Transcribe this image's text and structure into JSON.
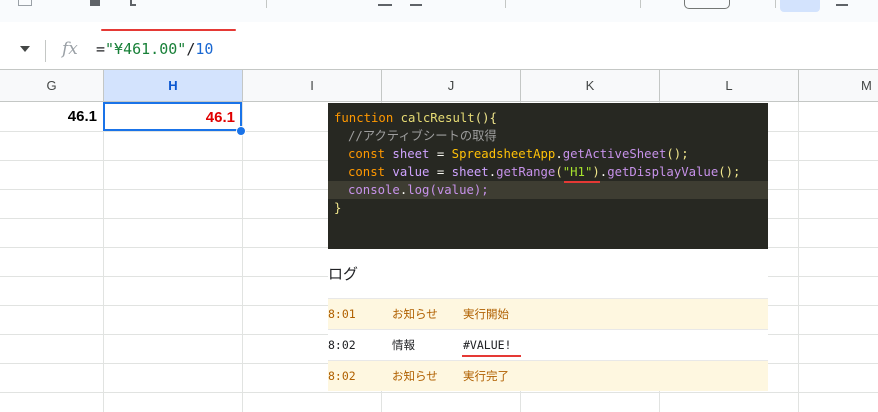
{
  "formula_bar": {
    "fx_label": "fx",
    "formula_prefix": "=",
    "formula_string": "\"¥461.00\"",
    "formula_operator": "/",
    "formula_number": "10"
  },
  "columns": [
    "G",
    "H",
    "I",
    "J",
    "K",
    "L",
    "M"
  ],
  "selected_column": "H",
  "cells": {
    "g1": "46.1",
    "h1": "46.1"
  },
  "code": {
    "lines": [
      [
        "function ",
        "calcResult",
        "(){"
      ],
      [
        "//アクティブシートの取得"
      ],
      [
        "const ",
        "sheet",
        " = ",
        "SpreadsheetApp",
        ".",
        "getActiveSheet",
        "();"
      ],
      [
        "const ",
        "value",
        " = ",
        "sheet",
        ".",
        "getRange",
        "(",
        "\"H1\"",
        ")",
        ".",
        "getDisplayValue",
        "();"
      ],
      [
        "console",
        ".",
        "log",
        "(value);"
      ],
      [
        "}"
      ]
    ]
  },
  "log": {
    "title": "ログ",
    "rows": [
      {
        "time": "8:01",
        "severity": "お知らせ",
        "message": "実行開始"
      },
      {
        "time": "8:02",
        "severity": "情報",
        "message": "#VALUE!"
      },
      {
        "time": "8:02",
        "severity": "お知らせ",
        "message": "実行完了"
      }
    ]
  },
  "colors": {
    "accent": "#1a73e8",
    "error_red": "#e00000",
    "annotation_red": "#e53935",
    "notice_bg": "#fef7e0"
  }
}
